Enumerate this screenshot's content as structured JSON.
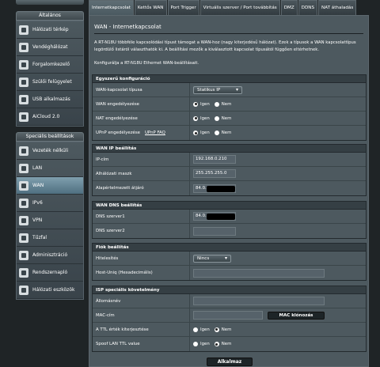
{
  "sidebar": {
    "section_general": "Általános",
    "general_items": [
      {
        "label": "Hálózati térkép",
        "icon": "network-map-icon"
      },
      {
        "label": "Vendéghálózat",
        "icon": "guest-network-icon"
      },
      {
        "label": "Forgalomkezelő",
        "icon": "traffic-manager-icon"
      },
      {
        "label": "Szülői felügyelet",
        "icon": "parental-control-icon"
      },
      {
        "label": "USB alkalmazás",
        "icon": "usb-icon"
      },
      {
        "label": "AiCloud 2.0",
        "icon": "cloud-icon"
      }
    ],
    "section_advanced": "Speciális beállítások",
    "advanced_items": [
      {
        "label": "Vezeték nélküli",
        "icon": "wireless-icon"
      },
      {
        "label": "LAN",
        "icon": "lan-icon"
      },
      {
        "label": "WAN",
        "icon": "wan-icon",
        "active": true
      },
      {
        "label": "IPv6",
        "icon": "ipv6-icon"
      },
      {
        "label": "VPN",
        "icon": "vpn-icon"
      },
      {
        "label": "Tűzfal",
        "icon": "firewall-icon"
      },
      {
        "label": "Adminisztráció",
        "icon": "admin-icon"
      },
      {
        "label": "Rendszernapló",
        "icon": "system-log-icon"
      },
      {
        "label": "Hálózati eszközök",
        "icon": "network-tools-icon"
      }
    ]
  },
  "tabs": [
    {
      "label": "Internetkapcsolat",
      "active": true
    },
    {
      "label": "Kettős WAN"
    },
    {
      "label": "Port Trigger"
    },
    {
      "label": "Virtuális szerver / Port továbbítás"
    },
    {
      "label": "DMZ"
    },
    {
      "label": "DDNS"
    },
    {
      "label": "NAT áthaladás"
    }
  ],
  "page": {
    "title": "WAN - Internetkapcsolat",
    "intro": "A RT-N18U többféle kapcsolódási típust támogat a WAN-hoz (nagy kiterjedésű hálózat). Ezek a típusok a WAN kapcsolattípus legördülő listáról választhatók ki. A beállítási mezők a kiválasztott kapcsolat típusától függően eltérhetnek.",
    "intro2": "Konfigurálja a RT-N18U Ethernet WAN-beállításait."
  },
  "basic": {
    "header": "Egyszerű konfiguráció",
    "wan_type_label": "WAN-kapcsolat típusa",
    "wan_type_value": "Statikus IP",
    "enable_wan_label": "WAN engedélyezése",
    "enable_nat_label": "NAT engedélyezése",
    "enable_upnp_label": "UPnP engedélyezése",
    "upnp_faq": "UPnP  FAQ",
    "yes": "Igen",
    "no": "Nem"
  },
  "wan_ip": {
    "header": "WAN IP beállítás",
    "ip_label": "IP-cím",
    "ip_value": "192.168.0.210",
    "mask_label": "Alhálózati maszk",
    "mask_value": "255.255.255.0",
    "gateway_label": "Alapértelmezett átjáró",
    "gateway_value": "84.0."
  },
  "wan_dns": {
    "header": "WAN DNS beállítás",
    "dns1_label": "DNS szerver1",
    "dns1_value": "84.0.",
    "dns2_label": "DNS szerver2",
    "dns2_value": ""
  },
  "account": {
    "header": "Fiók beállítás",
    "auth_label": "Hitelesítés",
    "auth_value": "Nincs",
    "hostuniq_label": "Host-Uniq (Hexadecimális)",
    "hostuniq_value": ""
  },
  "isp": {
    "header": "ISP speciális követelmény",
    "hostname_label": "Állomásnév",
    "hostname_value": "",
    "mac_label": "MAC-cím",
    "mac_value": "",
    "mac_clone_button": "MAC klónozás",
    "ttl_label": "A TTL érték kiterjesztése",
    "spoof_ttl_label": "Spoof LAN TTL value"
  },
  "apply_button": "Alkalmaz"
}
